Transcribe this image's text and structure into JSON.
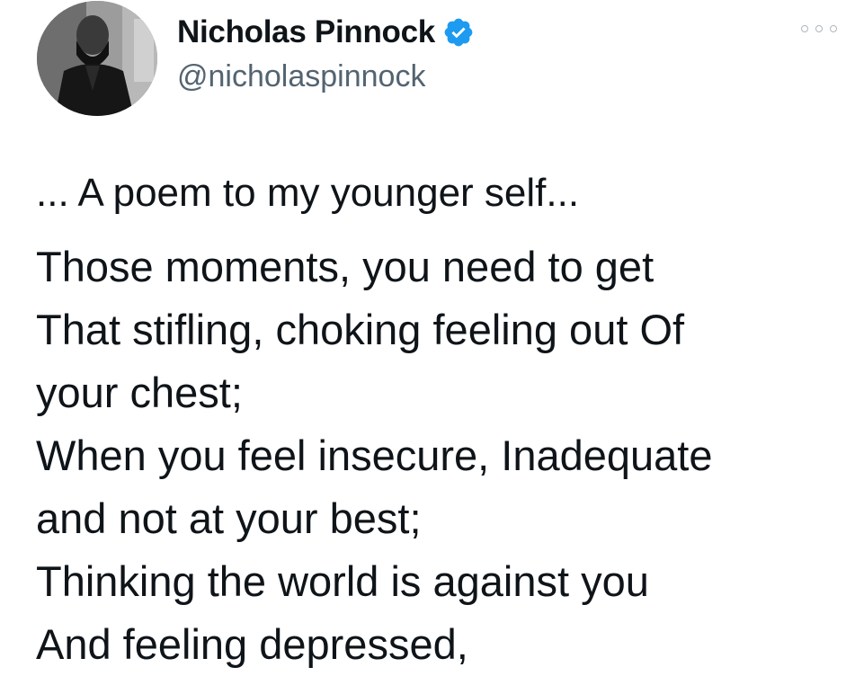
{
  "tweet": {
    "author": {
      "display_name": "Nicholas Pinnock",
      "handle": "@nicholaspinnock",
      "verified_icon": "verified-badge-icon",
      "avatar_icon": "avatar-photo"
    },
    "more_icon": "more-horizontal-icon",
    "intro": "... A poem to my younger self...",
    "lines": [
      "Those moments, you need to get",
      "That stifling, choking feeling out Of",
      "your chest;",
      "When you feel insecure, Inadequate",
      "and not at your best;",
      "Thinking the world is against you",
      "And feeling depressed,"
    ]
  },
  "colors": {
    "text": "#0f1419",
    "secondary_text": "#536471",
    "verified_blue": "#1d9bf0",
    "background": "#ffffff"
  }
}
